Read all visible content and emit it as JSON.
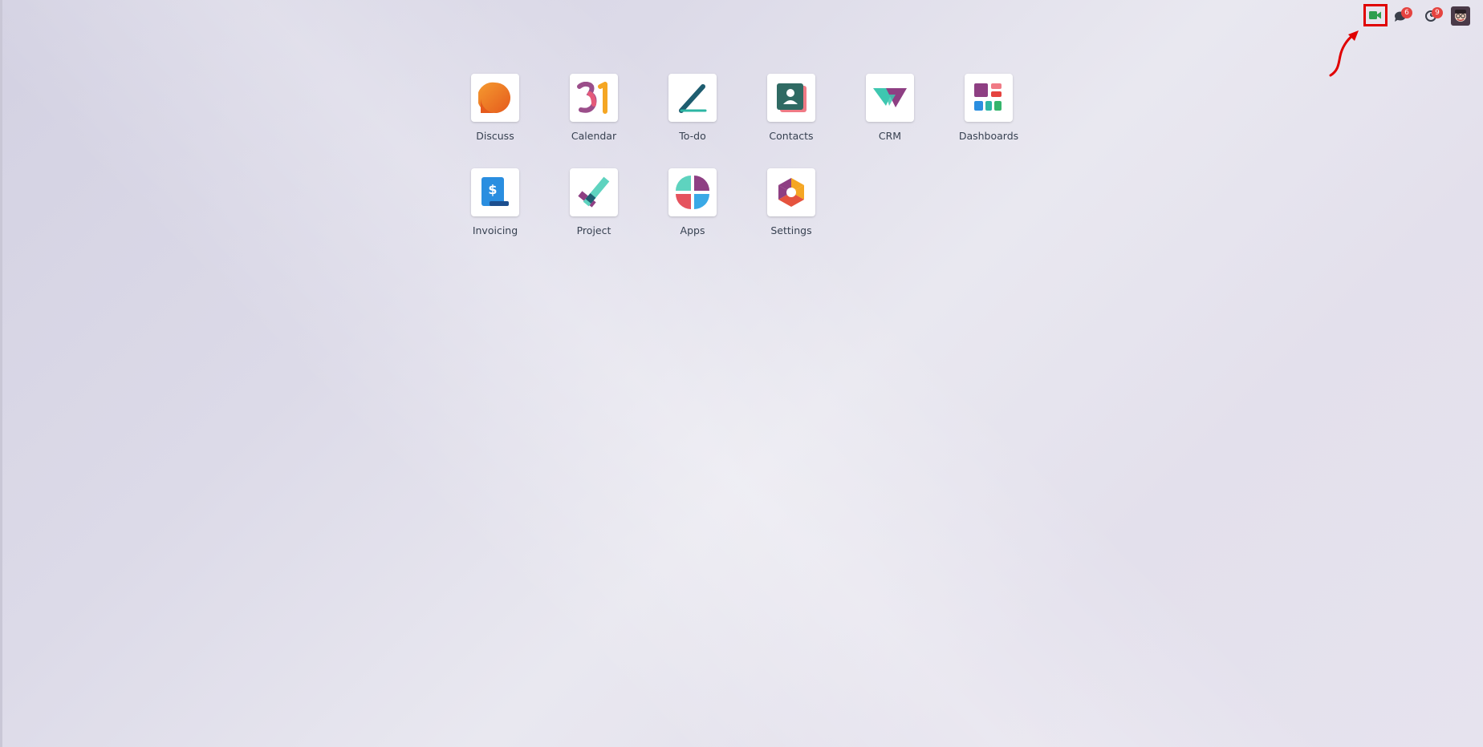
{
  "systray": {
    "video_icon": "video-camera-icon",
    "chat_badge": "6",
    "activity_badge": "9"
  },
  "apps": [
    {
      "label": "Discuss",
      "icon": "discuss-icon"
    },
    {
      "label": "Calendar",
      "icon": "calendar-icon",
      "icon_text": "31"
    },
    {
      "label": "To-do",
      "icon": "todo-icon"
    },
    {
      "label": "Contacts",
      "icon": "contacts-icon"
    },
    {
      "label": "CRM",
      "icon": "crm-icon"
    },
    {
      "label": "Dashboards",
      "icon": "dashboards-icon"
    },
    {
      "label": "Invoicing",
      "icon": "invoicing-icon",
      "icon_text": "$"
    },
    {
      "label": "Project",
      "icon": "project-icon"
    },
    {
      "label": "Apps",
      "icon": "apps-icon"
    },
    {
      "label": "Settings",
      "icon": "settings-icon"
    }
  ],
  "colors": {
    "highlight": "#e00000",
    "badge": "#e5433f",
    "video_green": "#2e9e4f"
  }
}
